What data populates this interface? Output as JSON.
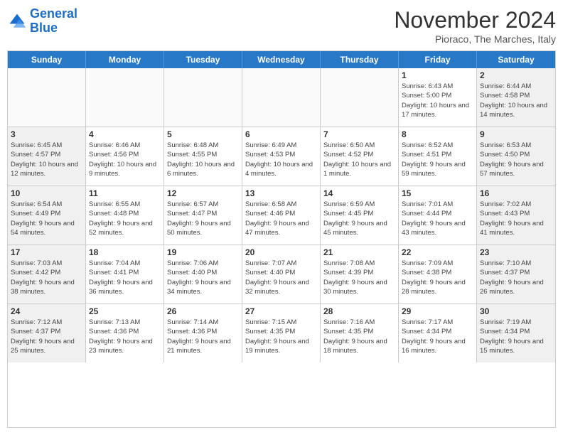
{
  "logo": {
    "line1": "General",
    "line2": "Blue"
  },
  "title": "November 2024",
  "location": "Pioraco, The Marches, Italy",
  "weekdays": [
    "Sunday",
    "Monday",
    "Tuesday",
    "Wednesday",
    "Thursday",
    "Friday",
    "Saturday"
  ],
  "rows": [
    [
      {
        "day": "",
        "info": ""
      },
      {
        "day": "",
        "info": ""
      },
      {
        "day": "",
        "info": ""
      },
      {
        "day": "",
        "info": ""
      },
      {
        "day": "",
        "info": ""
      },
      {
        "day": "1",
        "info": "Sunrise: 6:43 AM\nSunset: 5:00 PM\nDaylight: 10 hours and 17 minutes."
      },
      {
        "day": "2",
        "info": "Sunrise: 6:44 AM\nSunset: 4:58 PM\nDaylight: 10 hours and 14 minutes."
      }
    ],
    [
      {
        "day": "3",
        "info": "Sunrise: 6:45 AM\nSunset: 4:57 PM\nDaylight: 10 hours and 12 minutes."
      },
      {
        "day": "4",
        "info": "Sunrise: 6:46 AM\nSunset: 4:56 PM\nDaylight: 10 hours and 9 minutes."
      },
      {
        "day": "5",
        "info": "Sunrise: 6:48 AM\nSunset: 4:55 PM\nDaylight: 10 hours and 6 minutes."
      },
      {
        "day": "6",
        "info": "Sunrise: 6:49 AM\nSunset: 4:53 PM\nDaylight: 10 hours and 4 minutes."
      },
      {
        "day": "7",
        "info": "Sunrise: 6:50 AM\nSunset: 4:52 PM\nDaylight: 10 hours and 1 minute."
      },
      {
        "day": "8",
        "info": "Sunrise: 6:52 AM\nSunset: 4:51 PM\nDaylight: 9 hours and 59 minutes."
      },
      {
        "day": "9",
        "info": "Sunrise: 6:53 AM\nSunset: 4:50 PM\nDaylight: 9 hours and 57 minutes."
      }
    ],
    [
      {
        "day": "10",
        "info": "Sunrise: 6:54 AM\nSunset: 4:49 PM\nDaylight: 9 hours and 54 minutes."
      },
      {
        "day": "11",
        "info": "Sunrise: 6:55 AM\nSunset: 4:48 PM\nDaylight: 9 hours and 52 minutes."
      },
      {
        "day": "12",
        "info": "Sunrise: 6:57 AM\nSunset: 4:47 PM\nDaylight: 9 hours and 50 minutes."
      },
      {
        "day": "13",
        "info": "Sunrise: 6:58 AM\nSunset: 4:46 PM\nDaylight: 9 hours and 47 minutes."
      },
      {
        "day": "14",
        "info": "Sunrise: 6:59 AM\nSunset: 4:45 PM\nDaylight: 9 hours and 45 minutes."
      },
      {
        "day": "15",
        "info": "Sunrise: 7:01 AM\nSunset: 4:44 PM\nDaylight: 9 hours and 43 minutes."
      },
      {
        "day": "16",
        "info": "Sunrise: 7:02 AM\nSunset: 4:43 PM\nDaylight: 9 hours and 41 minutes."
      }
    ],
    [
      {
        "day": "17",
        "info": "Sunrise: 7:03 AM\nSunset: 4:42 PM\nDaylight: 9 hours and 38 minutes."
      },
      {
        "day": "18",
        "info": "Sunrise: 7:04 AM\nSunset: 4:41 PM\nDaylight: 9 hours and 36 minutes."
      },
      {
        "day": "19",
        "info": "Sunrise: 7:06 AM\nSunset: 4:40 PM\nDaylight: 9 hours and 34 minutes."
      },
      {
        "day": "20",
        "info": "Sunrise: 7:07 AM\nSunset: 4:40 PM\nDaylight: 9 hours and 32 minutes."
      },
      {
        "day": "21",
        "info": "Sunrise: 7:08 AM\nSunset: 4:39 PM\nDaylight: 9 hours and 30 minutes."
      },
      {
        "day": "22",
        "info": "Sunrise: 7:09 AM\nSunset: 4:38 PM\nDaylight: 9 hours and 28 minutes."
      },
      {
        "day": "23",
        "info": "Sunrise: 7:10 AM\nSunset: 4:37 PM\nDaylight: 9 hours and 26 minutes."
      }
    ],
    [
      {
        "day": "24",
        "info": "Sunrise: 7:12 AM\nSunset: 4:37 PM\nDaylight: 9 hours and 25 minutes."
      },
      {
        "day": "25",
        "info": "Sunrise: 7:13 AM\nSunset: 4:36 PM\nDaylight: 9 hours and 23 minutes."
      },
      {
        "day": "26",
        "info": "Sunrise: 7:14 AM\nSunset: 4:36 PM\nDaylight: 9 hours and 21 minutes."
      },
      {
        "day": "27",
        "info": "Sunrise: 7:15 AM\nSunset: 4:35 PM\nDaylight: 9 hours and 19 minutes."
      },
      {
        "day": "28",
        "info": "Sunrise: 7:16 AM\nSunset: 4:35 PM\nDaylight: 9 hours and 18 minutes."
      },
      {
        "day": "29",
        "info": "Sunrise: 7:17 AM\nSunset: 4:34 PM\nDaylight: 9 hours and 16 minutes."
      },
      {
        "day": "30",
        "info": "Sunrise: 7:19 AM\nSunset: 4:34 PM\nDaylight: 9 hours and 15 minutes."
      }
    ]
  ]
}
